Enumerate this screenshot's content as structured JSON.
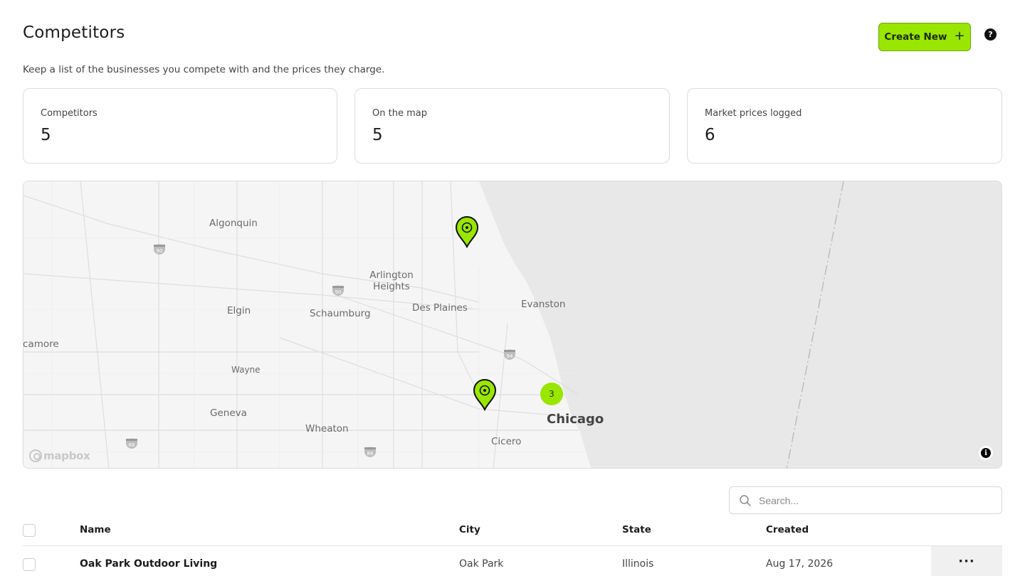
{
  "header": {
    "title": "Competitors",
    "subtitle": "Keep a list of the businesses you compete with and the prices they charge.",
    "create_button": "Create New",
    "create_plus": "+",
    "help_icon": "?"
  },
  "stats": [
    {
      "label": "Competitors",
      "value": "5"
    },
    {
      "label": "On the map",
      "value": "5"
    },
    {
      "label": "Market prices logged",
      "value": "6"
    }
  ],
  "map": {
    "places": {
      "algonquin": "Algonquin",
      "arlington_1": "Arlington",
      "arlington_2": "Heights",
      "des_plaines": "Des Plaines",
      "evanston": "Evanston",
      "elgin": "Elgin",
      "schaumburg": "Schaumburg",
      "sycamore": "camore",
      "wayne": "Wayne",
      "geneva": "Geneva",
      "wheaton": "Wheaton",
      "cicero": "Cicero",
      "chicago": "Chicago"
    },
    "shields": [
      "90",
      "90",
      "94",
      "88",
      "88"
    ],
    "cluster_count": "3",
    "attribution": "mapbox",
    "info_icon": "i",
    "colors": {
      "marker": "#99e600",
      "water": "#e8e8e8",
      "land": "#f5f5f5"
    }
  },
  "search": {
    "placeholder": "Search..."
  },
  "table": {
    "columns": [
      "Name",
      "City",
      "State",
      "Created"
    ],
    "rows": [
      {
        "name": "Oak Park Outdoor Living",
        "city": "Oak Park",
        "state": "Illinois",
        "created": "Aug 17, 2026",
        "actions": "···"
      }
    ]
  },
  "colors": {
    "accent": "#99e600",
    "border": "#dcdcdc"
  }
}
